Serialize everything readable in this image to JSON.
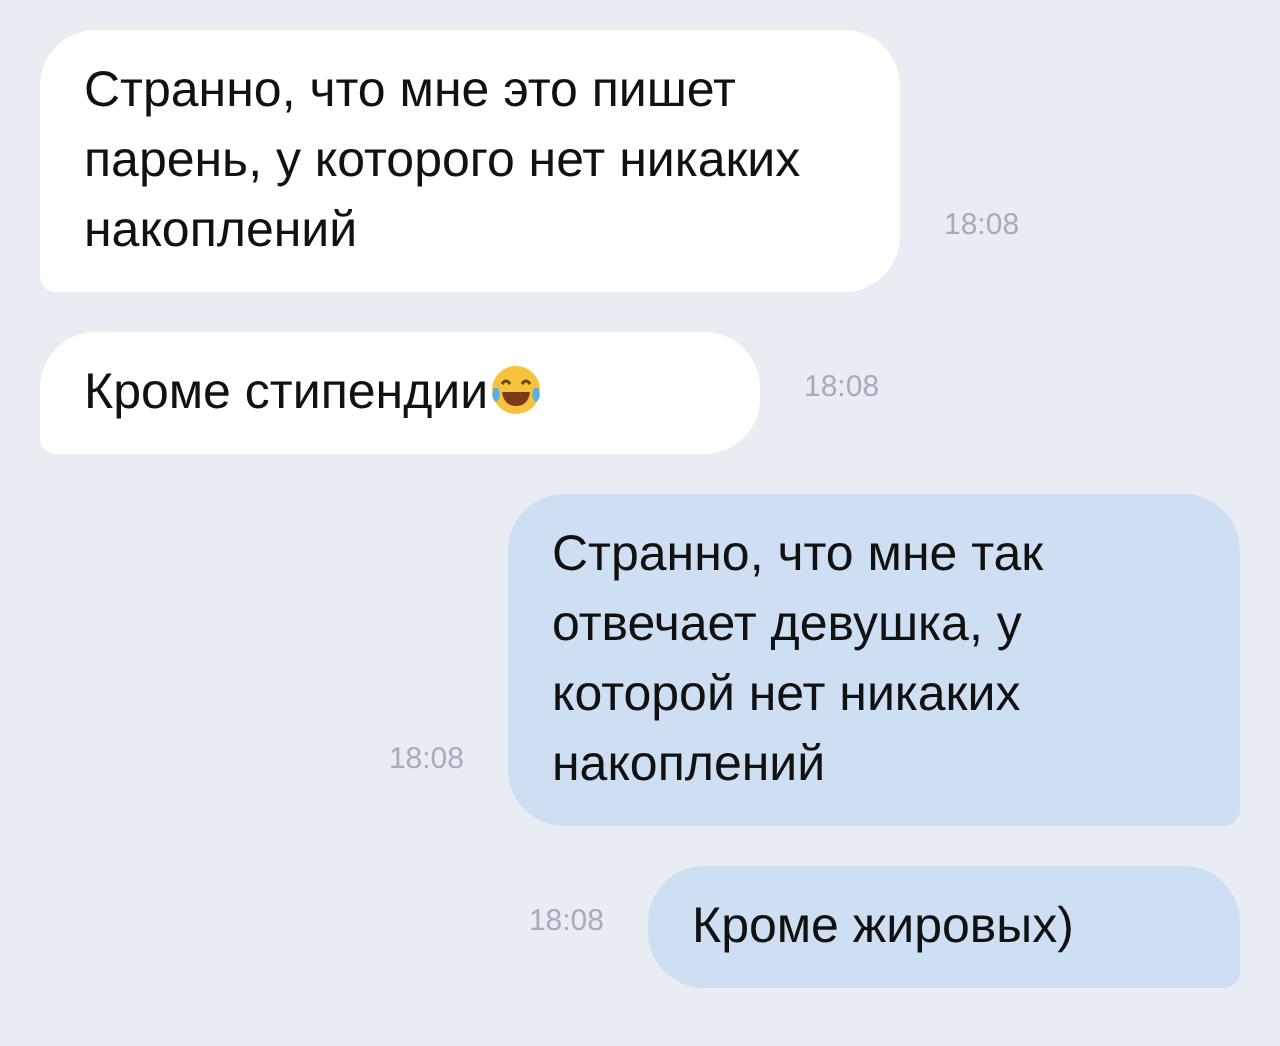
{
  "messages": [
    {
      "kind": "incoming",
      "text": "Странно, что мне это пишет парень, у которого нет никаких накоплений",
      "time": "18:08",
      "emoji": false
    },
    {
      "kind": "incoming",
      "text": "Кроме стипендии",
      "time": "18:08",
      "emoji": true
    },
    {
      "kind": "outgoing",
      "text": "Странно, что мне так отвечает девушка, у которой нет никаких накоплений",
      "time": "18:08",
      "emoji": false
    },
    {
      "kind": "outgoing",
      "text": "Кроме жировых)",
      "time": "18:08",
      "emoji": false
    }
  ]
}
